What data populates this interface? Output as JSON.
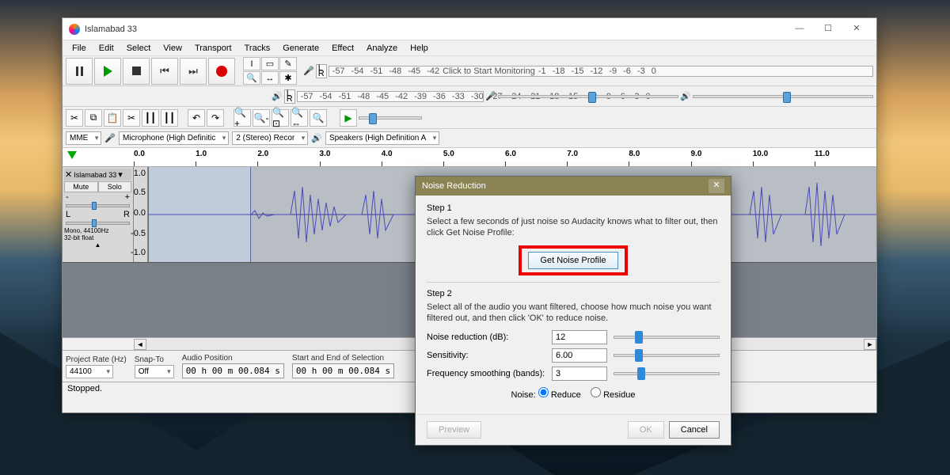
{
  "window": {
    "title": "Islamabad 33"
  },
  "win_btns": {
    "min": "—",
    "max": "☐",
    "close": "✕"
  },
  "menu": [
    "File",
    "Edit",
    "Select",
    "View",
    "Transport",
    "Tracks",
    "Generate",
    "Effect",
    "Analyze",
    "Help"
  ],
  "tool_grid": [
    "I",
    "▭",
    "✎",
    "🔍",
    "↔",
    "✱"
  ],
  "meter_rec": {
    "label": "Click to Start Monitoring",
    "ticks": [
      "-57",
      "-54",
      "-51",
      "-48",
      "-45",
      "-42"
    ],
    "ticks2": [
      "-1",
      "-18",
      "-15",
      "-12",
      "-9",
      "-6",
      "-3",
      "0"
    ]
  },
  "meter_play": {
    "ticks": [
      "-57",
      "-54",
      "-51",
      "-48",
      "-45",
      "-42",
      "-39",
      "-36",
      "-33",
      "-30",
      "-27",
      "-24",
      "-21",
      "-18",
      "-15",
      "-12",
      "-9",
      "-6",
      "-3",
      "0"
    ]
  },
  "edit_icons": [
    "✂",
    "⧉",
    "📋",
    "✂",
    "┃┃",
    "┃┃",
    "↶",
    "↷",
    "🔍+",
    "🔍-",
    "🔍⊡",
    "🔍⇔",
    "🔍"
  ],
  "play2": "▶",
  "devices": {
    "host": "MME",
    "in": "Microphone (High Definitic",
    "ch": "2 (Stereo) Recor",
    "out": "Speakers (High Definition A"
  },
  "timeline": [
    "0.0",
    "1.0",
    "2.0",
    "3.0",
    "4.0",
    "5.0",
    "6.0",
    "7.0",
    "8.0",
    "9.0",
    "10.0",
    "11.0"
  ],
  "track": {
    "name": "Islamabad 33",
    "mute": "Mute",
    "solo": "Solo",
    "info1": "Mono, 44100Hz",
    "info2": "32-bit float",
    "scale": [
      "1.0",
      "0.5",
      "0.0",
      "-0.5",
      "-1.0"
    ],
    "pan_l": "L",
    "pan_r": "R",
    "gain_m": "-",
    "gain_p": "+"
  },
  "bottom": {
    "rate_label": "Project Rate (Hz)",
    "rate": "44100",
    "snap_label": "Snap-To",
    "snap": "Off",
    "pos_label": "Audio Position",
    "pos": "00 h 00 m 00.084 s",
    "sel_label": "Start and End of Selection",
    "sel_start": "00 h 00 m 00.084 s"
  },
  "status": "Stopped.",
  "dialog": {
    "title": "Noise Reduction",
    "step1": "Step 1",
    "step1_desc": "Select a few seconds of just noise so Audacity knows what to filter out, then click Get Noise Profile:",
    "get_profile": "Get Noise Profile",
    "step2": "Step 2",
    "step2_desc": "Select all of the audio you want filtered, choose how much noise you want filtered out, and then click 'OK' to reduce noise.",
    "nr_label": "Noise reduction (dB):",
    "nr_val": "12",
    "sens_label": "Sensitivity:",
    "sens_val": "6.00",
    "freq_label": "Frequency smoothing (bands):",
    "freq_val": "3",
    "noise_label": "Noise:",
    "reduce": "Reduce",
    "residue": "Residue",
    "preview": "Preview",
    "ok": "OK",
    "cancel": "Cancel"
  }
}
